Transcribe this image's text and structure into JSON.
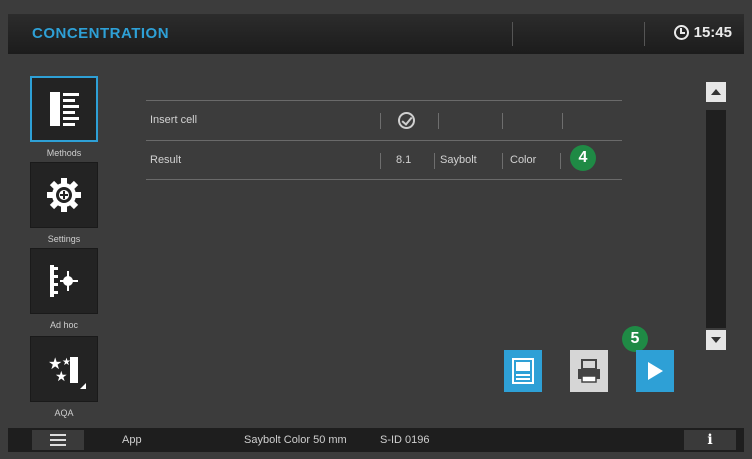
{
  "header": {
    "title": "CONCENTRATION",
    "time": "15:45",
    "clock_icon": "clock-icon"
  },
  "sidebar": {
    "items": [
      {
        "label": "Methods",
        "icon": "methods-list-icon",
        "active": true
      },
      {
        "label": "Settings",
        "icon": "gear-icon",
        "active": false
      },
      {
        "label": "Ad hoc",
        "icon": "ad-hoc-icon",
        "active": false
      },
      {
        "label": "AQA",
        "icon": "aqa-stars-icon",
        "active": false
      }
    ]
  },
  "table": {
    "row1": {
      "label": "Insert cell",
      "status_icon": "check-circle-icon"
    },
    "row2": {
      "label": "Result",
      "value": "8.1",
      "unit1": "Saybolt",
      "unit2": "Color"
    }
  },
  "markers": {
    "m4": "4",
    "m5": "5"
  },
  "buttons": {
    "save": "save-icon",
    "print": "print-icon",
    "start": "play-icon"
  },
  "footer": {
    "app": "App",
    "method": "Saybolt Color 50 mm",
    "sample_id": "S-ID 0196",
    "info": "i"
  },
  "colors": {
    "accent": "#2ea0d6",
    "marker": "#1f8a45",
    "background": "#3c3c3c"
  }
}
